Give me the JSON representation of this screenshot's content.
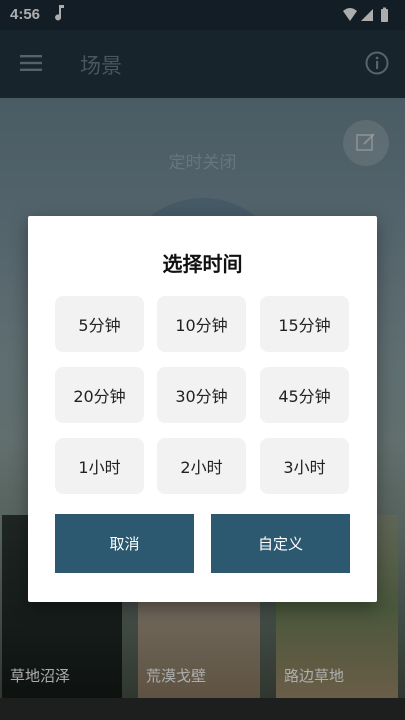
{
  "status_bar": {
    "time": "4:56"
  },
  "app_bar": {
    "title": "场景"
  },
  "scene": {
    "timer_label": "定时关闭"
  },
  "tiles": [
    {
      "label": "草地沼泽"
    },
    {
      "label": "荒漠戈壁"
    },
    {
      "label": "路边草地"
    }
  ],
  "dialog": {
    "title": "选择时间",
    "options": [
      "5分钟",
      "10分钟",
      "15分钟",
      "20分钟",
      "30分钟",
      "45分钟",
      "1小时",
      "2小时",
      "3小时"
    ],
    "cancel_label": "取消",
    "custom_label": "自定义"
  },
  "colors": {
    "accent": "#2c5870",
    "app_bar": "#223542"
  },
  "icons": [
    "music-note-icon",
    "wifi-icon",
    "signal-icon",
    "battery-icon",
    "menu-icon",
    "info-icon",
    "edit-icon"
  ]
}
